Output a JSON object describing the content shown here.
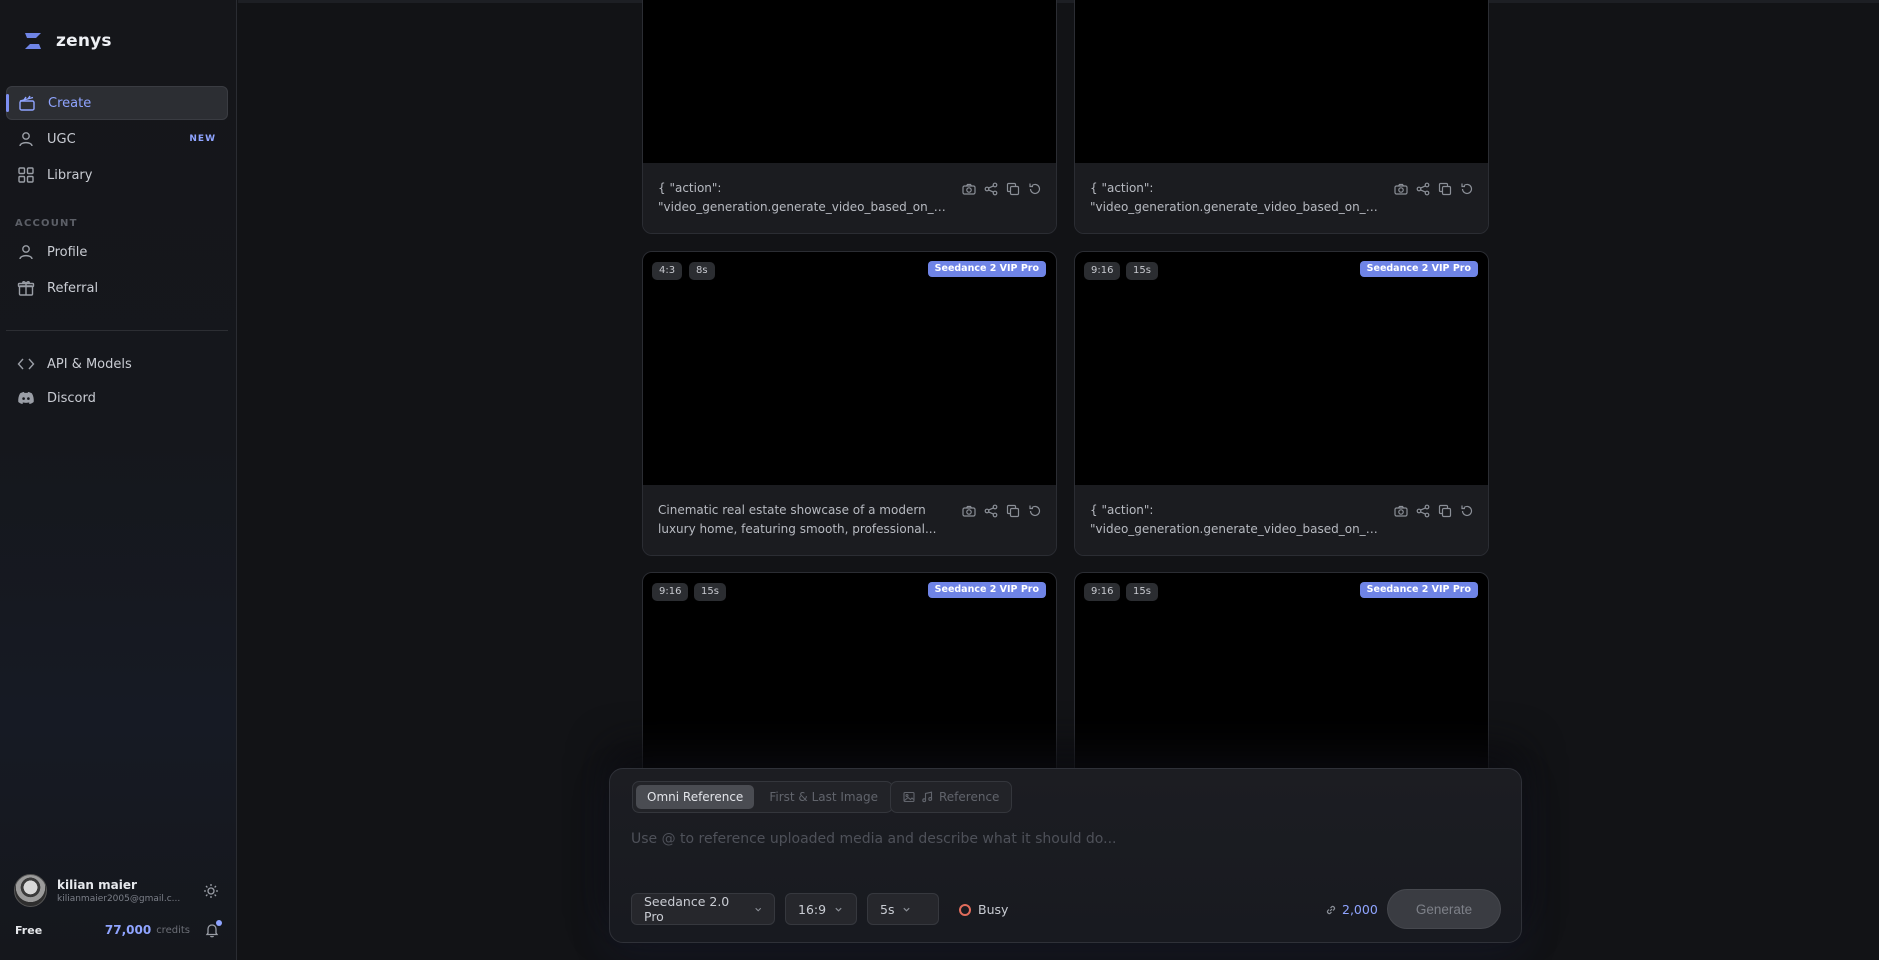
{
  "brand": {
    "name": "zenys"
  },
  "sidebar": {
    "items": [
      {
        "label": "Create",
        "icon": "clapperboard-icon",
        "active": true
      },
      {
        "label": "UGC",
        "icon": "user-icon",
        "badge": "NEW"
      },
      {
        "label": "Library",
        "icon": "grid-icon"
      }
    ],
    "section_label": "ACCOUNT",
    "account_items": [
      {
        "label": "Profile",
        "icon": "user-icon"
      },
      {
        "label": "Referral",
        "icon": "gift-icon"
      }
    ],
    "extra_items": [
      {
        "label": "API & Models",
        "icon": "code-icon"
      },
      {
        "label": "Discord",
        "icon": "discord-icon"
      }
    ]
  },
  "user": {
    "name": "kilian maier",
    "email": "kilianmaier2005@gmail.c...",
    "plan": "Free",
    "credits": "77,000",
    "credits_label": "credits"
  },
  "cards": [
    {
      "caption_line1": "{ \"action\":",
      "caption_line2": "\"video_generation.generate_video_based_on_i..."
    },
    {
      "caption_line1": "{ \"action\":",
      "caption_line2": "\"video_generation.generate_video_based_on_i..."
    },
    {
      "aspect": "4:3",
      "duration": "8s",
      "model": "Seedance 2 VIP Pro",
      "caption_line1": "Cinematic real estate showcase of a modern",
      "caption_line2": "luxury home, featuring smooth, professional..."
    },
    {
      "aspect": "9:16",
      "duration": "15s",
      "model": "Seedance 2 VIP Pro",
      "caption_line1": "{ \"action\":",
      "caption_line2": "\"video_generation.generate_video_based_on_i..."
    },
    {
      "aspect": "9:16",
      "duration": "15s",
      "model": "Seedance 2 VIP Pro"
    },
    {
      "aspect": "9:16",
      "duration": "15s",
      "model": "Seedance 2 VIP Pro"
    }
  ],
  "composer": {
    "modes": [
      "Omni Reference",
      "First & Last Image"
    ],
    "active_mode": "Omni Reference",
    "reference_label": "Reference",
    "placeholder": "Use @ to reference uploaded media and describe what it should do...",
    "model": "Seedance 2.0 Pro",
    "aspect": "16:9",
    "duration": "5s",
    "status": "Busy",
    "cost": "2,000",
    "generate_label": "Generate"
  },
  "colors": {
    "accent": "#8fa4ff",
    "badge": "#6f84e6",
    "busy": "#e06c5b"
  }
}
